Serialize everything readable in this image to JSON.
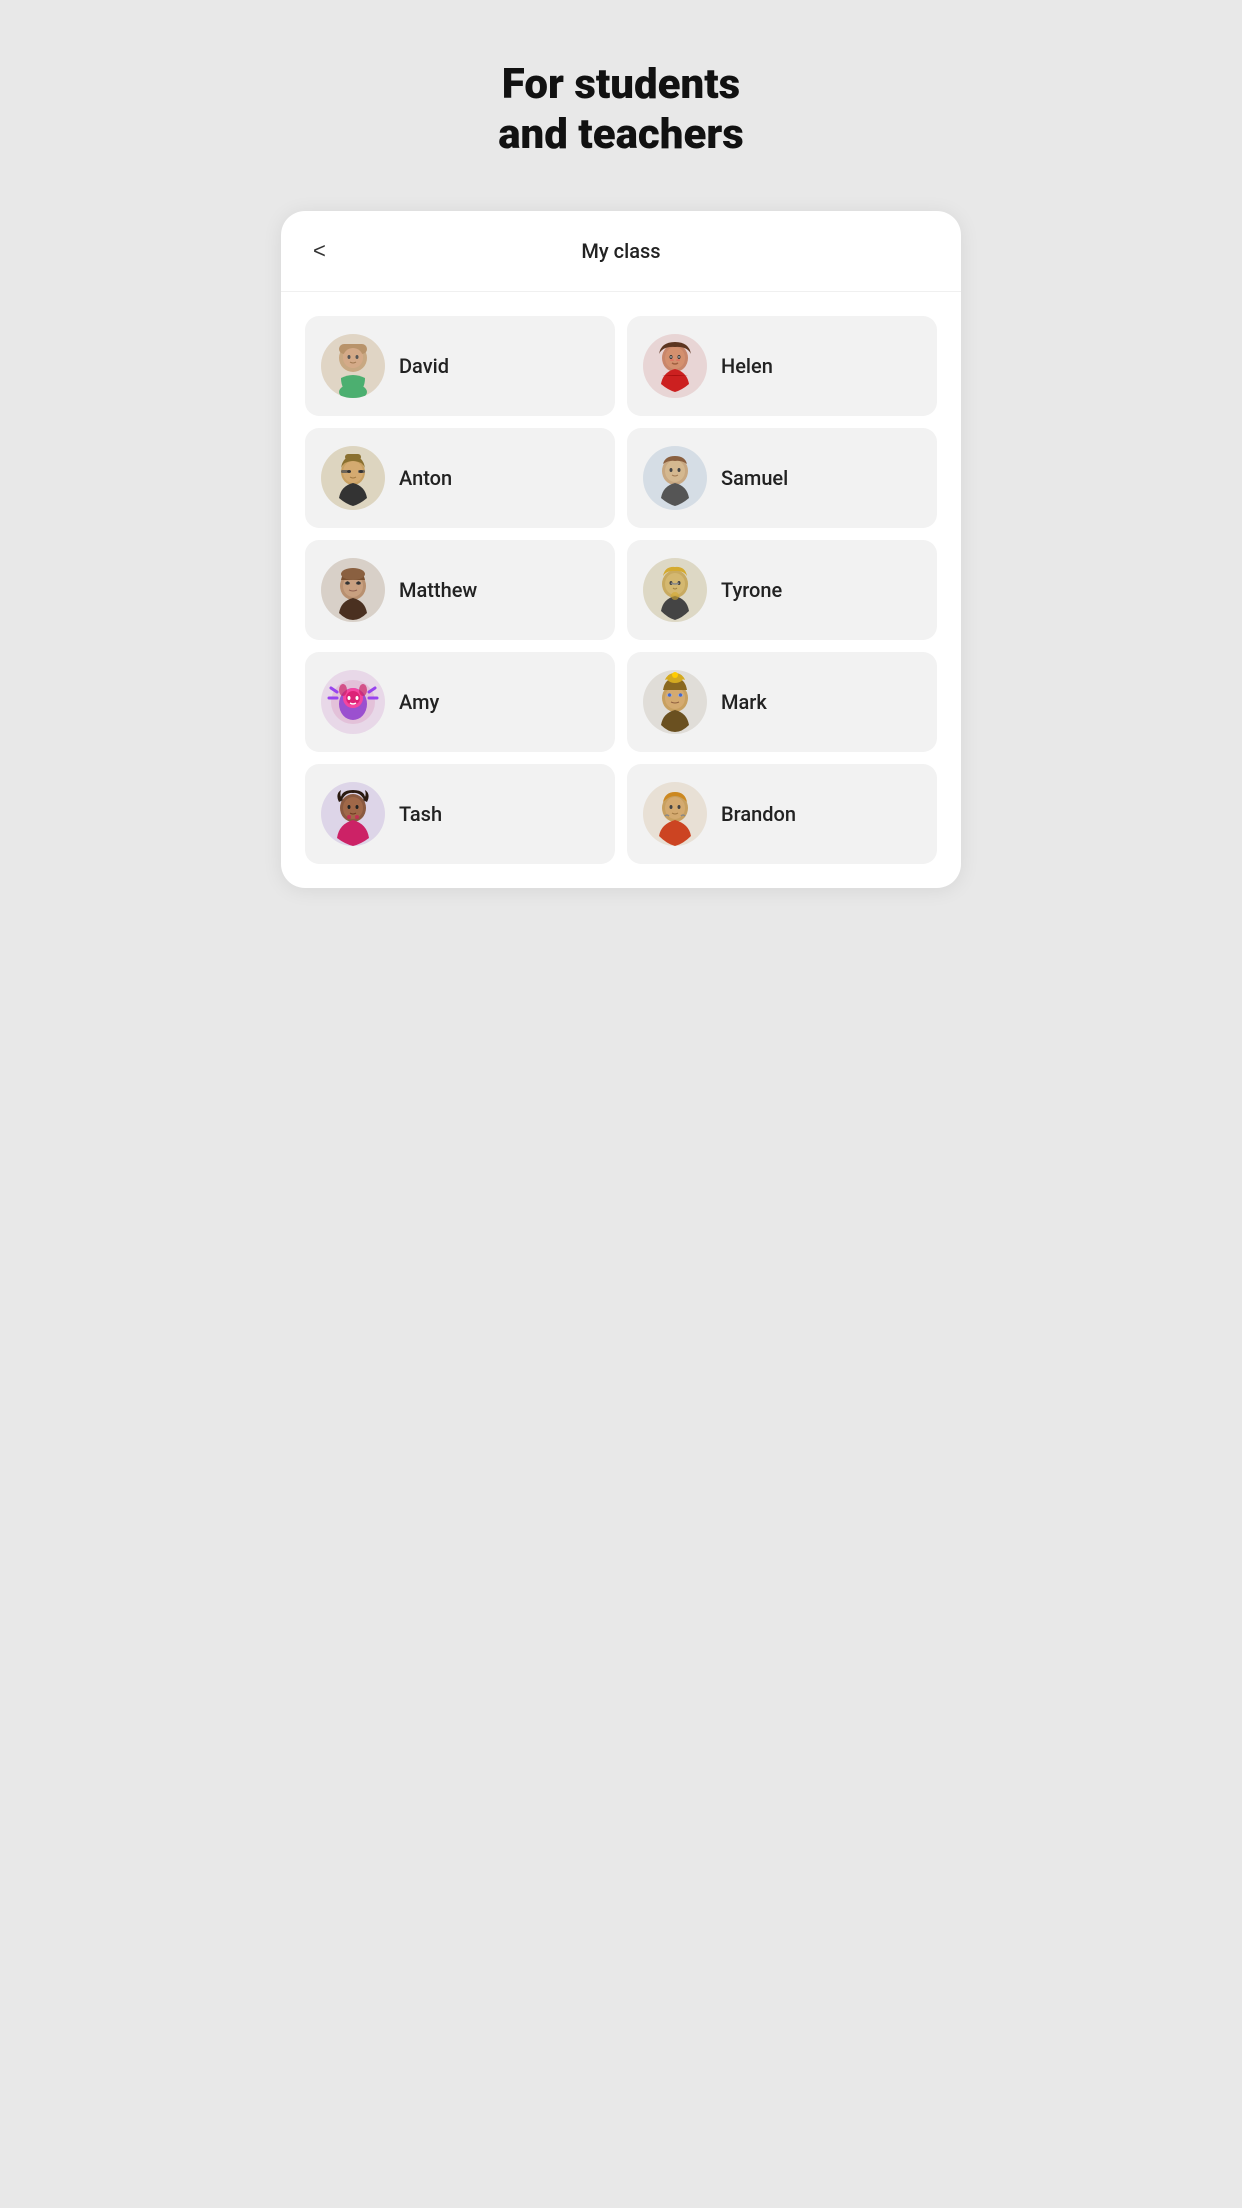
{
  "page": {
    "title_line1": "For students",
    "title_line2": "and teachers",
    "background_color": "#e8e8e8"
  },
  "card": {
    "back_label": "<",
    "title": "My class"
  },
  "students": [
    {
      "id": "david",
      "name": "David",
      "avatar_emoji": "🧑",
      "avatar_class": "avatar-david",
      "avatar_svg": "david"
    },
    {
      "id": "helen",
      "name": "Helen",
      "avatar_emoji": "👩",
      "avatar_class": "avatar-helen",
      "avatar_svg": "helen"
    },
    {
      "id": "anton",
      "name": "Anton",
      "avatar_emoji": "🧔",
      "avatar_class": "avatar-anton",
      "avatar_svg": "anton"
    },
    {
      "id": "samuel",
      "name": "Samuel",
      "avatar_emoji": "🧑",
      "avatar_class": "avatar-samuel",
      "avatar_svg": "samuel"
    },
    {
      "id": "matthew",
      "name": "Matthew",
      "avatar_emoji": "🧑",
      "avatar_class": "avatar-matthew",
      "avatar_svg": "matthew"
    },
    {
      "id": "tyrone",
      "name": "Tyrone",
      "avatar_emoji": "🧑",
      "avatar_class": "avatar-tyrone",
      "avatar_svg": "tyrone"
    },
    {
      "id": "amy",
      "name": "Amy",
      "avatar_emoji": "👾",
      "avatar_class": "avatar-amy",
      "avatar_svg": "amy"
    },
    {
      "id": "mark",
      "name": "Mark",
      "avatar_emoji": "🧑",
      "avatar_class": "avatar-mark",
      "avatar_svg": "mark"
    },
    {
      "id": "tash",
      "name": "Tash",
      "avatar_emoji": "👩",
      "avatar_class": "avatar-tash",
      "avatar_svg": "tash"
    },
    {
      "id": "brandon",
      "name": "Brandon",
      "avatar_emoji": "🧑",
      "avatar_class": "avatar-brandon",
      "avatar_svg": "brandon"
    }
  ]
}
